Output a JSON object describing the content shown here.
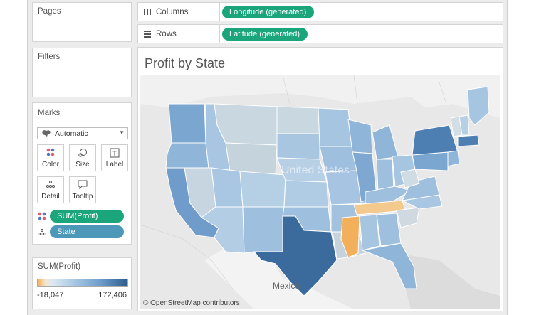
{
  "left_panel": {
    "pages_title": "Pages",
    "filters_title": "Filters",
    "marks": {
      "title": "Marks",
      "mark_type": "Automatic",
      "buttons": {
        "color": "Color",
        "size": "Size",
        "label": "Label",
        "detail": "Detail",
        "tooltip": "Tooltip"
      },
      "fields": [
        {
          "label": "SUM(Profit)",
          "icon": "color-dots-icon"
        },
        {
          "label": "State",
          "icon": "detail-dots-icon"
        }
      ]
    },
    "legend": {
      "title": "SUM(Profit)",
      "min": "-18,047",
      "max": "172,406"
    }
  },
  "shelves": {
    "columns": {
      "label": "Columns",
      "pill": "Longitude (generated)"
    },
    "rows": {
      "label": "Rows",
      "pill": "Latitude (generated)"
    }
  },
  "view": {
    "title": "Profit by State",
    "map_label": "United States",
    "neighbor_label": "Mexico",
    "attribution": "© OpenStreetMap contributors"
  },
  "colors": {
    "positive_high": "#2d5d8e",
    "positive_low": "#dce9f2",
    "negative": "#f2b05d",
    "pill_green": "#1aa57a",
    "pill_blue": "#4b98b8"
  }
}
